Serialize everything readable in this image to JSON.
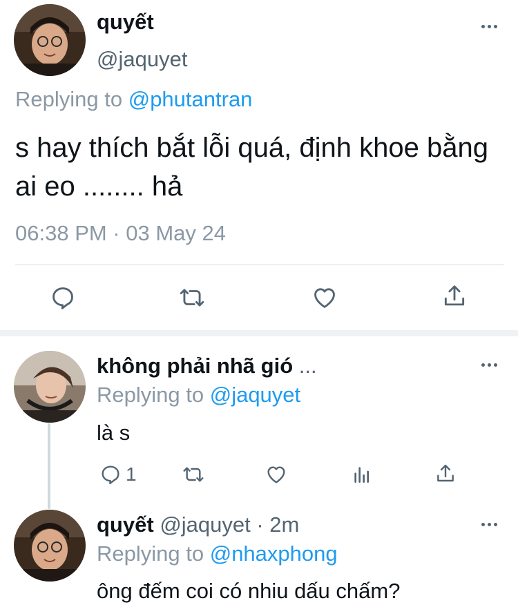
{
  "main_tweet": {
    "display_name": "quyết",
    "handle": "@jaquyet",
    "replying_prefix": "Replying to",
    "replying_to": "@phutantran",
    "text": "s hay thích bắt lỗi quá, định khoe bằng ai eo ........ hả",
    "timestamp": "06:38 PM · 03 May 24"
  },
  "reply1": {
    "display_name": "không phải nhã gió",
    "name_truncation": "...",
    "replying_prefix": "Replying to",
    "replying_to": "@jaquyet",
    "text": "là s",
    "reply_count": "1"
  },
  "reply2": {
    "display_name": "quyết",
    "handle_time": "@jaquyet · 2m",
    "replying_prefix": "Replying to",
    "replying_to": "@nhaxphong",
    "text": "ông đếm coi có nhiu dấu chấm?"
  },
  "colors": {
    "text": "#0f1419",
    "secondary": "#536471",
    "mention": "#1d9bf0",
    "divider": "#dcdfe3"
  },
  "icons": [
    "more-icon",
    "reply-icon",
    "retweet-icon",
    "like-icon",
    "share-icon",
    "views-icon"
  ]
}
